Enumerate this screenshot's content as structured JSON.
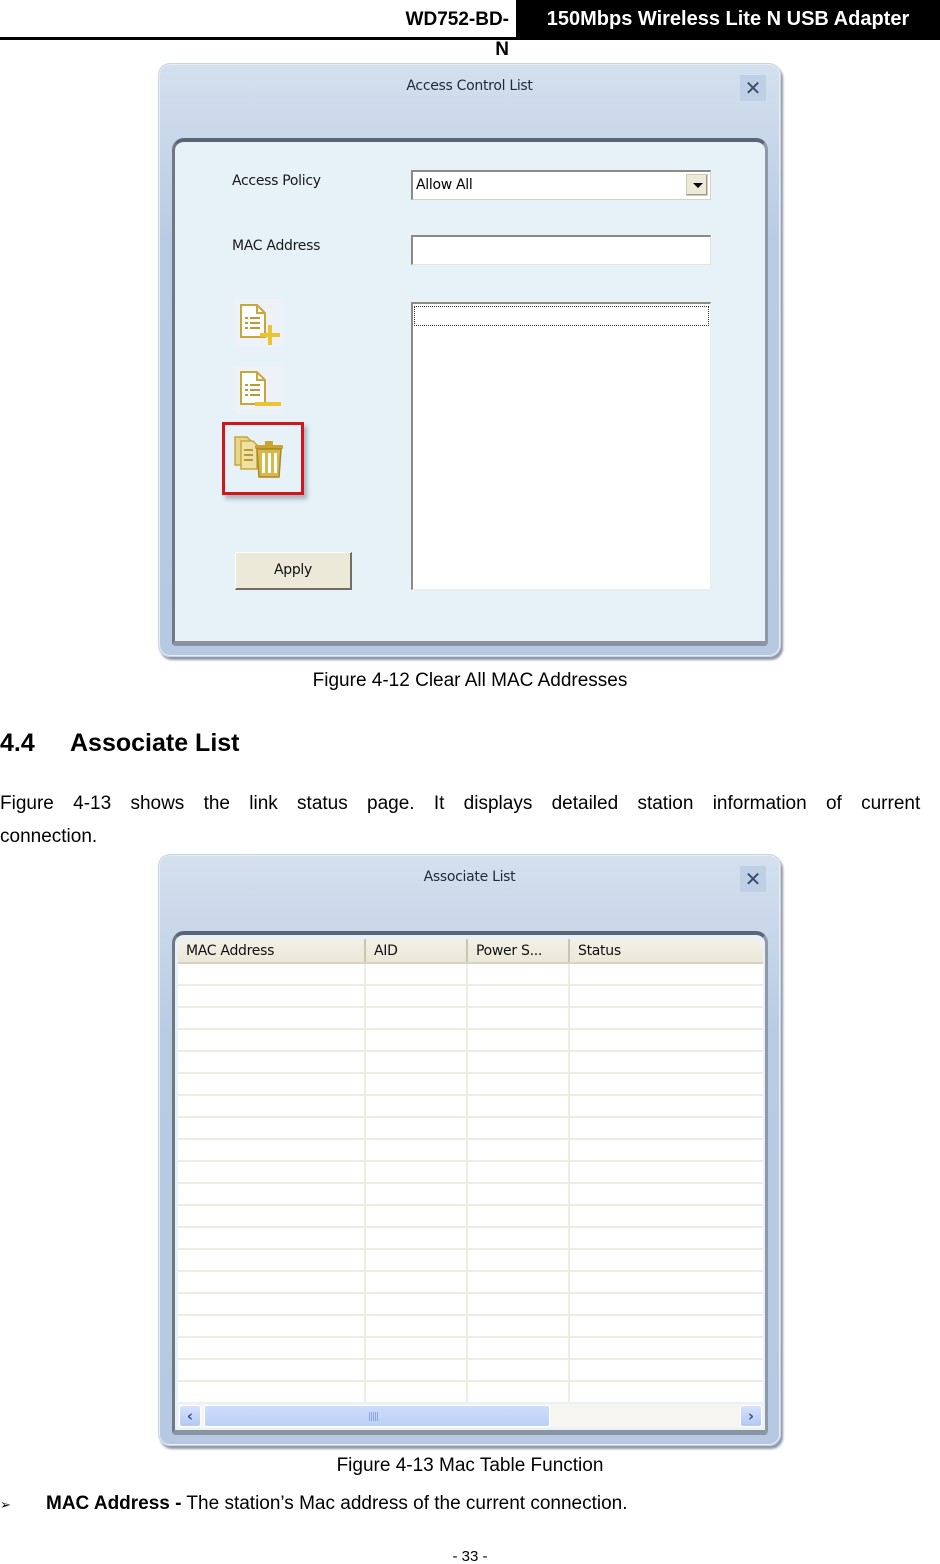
{
  "header": {
    "model": "WD752-BD-N",
    "product": "150Mbps Wireless Lite N USB Adapter"
  },
  "figure_12": {
    "dialog": {
      "title": "Access Control List",
      "close_icon": "close-icon",
      "access_policy_label": "Access Policy",
      "access_policy_value": "Allow All",
      "mac_address_label": "MAC Address",
      "mac_address_value": "",
      "mac_list_items": [],
      "toolbar_icons": [
        "add-entry-icon",
        "remove-entry-icon",
        "clear-all-icon"
      ],
      "highlighted_icon": "clear-all-icon",
      "highlight_color": "#d0151b",
      "apply_label": "Apply"
    },
    "caption": "Figure 4-12 Clear All MAC Addresses"
  },
  "section": {
    "number": "4.4",
    "title": "Associate List",
    "paragraph_line1": "Figure 4-13 shows the link status page. It displays detailed station information of current",
    "paragraph_line2": "connection."
  },
  "figure_13": {
    "dialog": {
      "title": "Associate List",
      "close_icon": "close-icon",
      "columns": [
        "MAC Address",
        "AID",
        "Power S...",
        "Status"
      ],
      "rows": [],
      "empty_row_count": 20,
      "scroll_left_icon": "chevron-left-icon",
      "scroll_right_icon": "chevron-right-icon"
    },
    "caption": "Figure 4-13 Mac Table Function"
  },
  "bullets": [
    {
      "icon": "arrow-bullet-icon",
      "term": "MAC Address -",
      "text": " The station’s Mac address of the current connection."
    }
  ],
  "footer": {
    "page_number": "- 33 -"
  }
}
